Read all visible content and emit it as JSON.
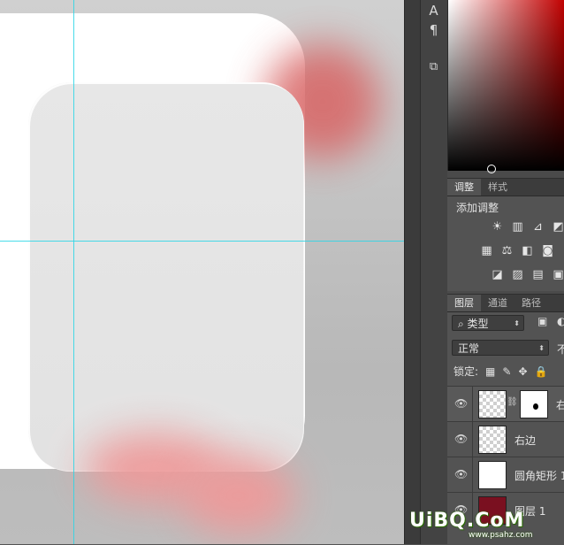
{
  "colors": {
    "guide": "#29d6e6",
    "blob": "#e06a6a",
    "panel_bg": "#535353"
  },
  "toolstrip_icons": [
    {
      "name": "text-tool-icon",
      "glyph": "A|"
    },
    {
      "name": "paragraph-icon",
      "glyph": "¶"
    },
    {
      "name": "3d-cube-icon",
      "glyph": "⧉"
    }
  ],
  "adjust_panel": {
    "tabs": [
      "调整",
      "样式"
    ],
    "title": "添加调整",
    "icons_row1": [
      "☀",
      "▥",
      "⊿",
      "◩"
    ],
    "icons_row2": [
      "▦",
      "⚖",
      "◧",
      "◙"
    ],
    "icons_row3": [
      "◪",
      "▨",
      "▤",
      "▣"
    ]
  },
  "layers_panel": {
    "tabs": [
      "图层",
      "通道",
      "路径"
    ],
    "filter_label": "类型",
    "blend_mode": "正常",
    "opacity_label": "不",
    "lock_label": "锁定:",
    "lock_icons": [
      "▦",
      "✎",
      "✥",
      "🔒"
    ],
    "layers": [
      {
        "name": "右",
        "thumb": "checker",
        "mask": true
      },
      {
        "name": "右边",
        "thumb": "checker"
      },
      {
        "name": "圆角矩形 1",
        "thumb": "white"
      },
      {
        "name": "图层 1",
        "thumb": "red"
      }
    ]
  },
  "watermark": {
    "main": "UiBQ.CoM",
    "sub": "www.psahz.com"
  }
}
